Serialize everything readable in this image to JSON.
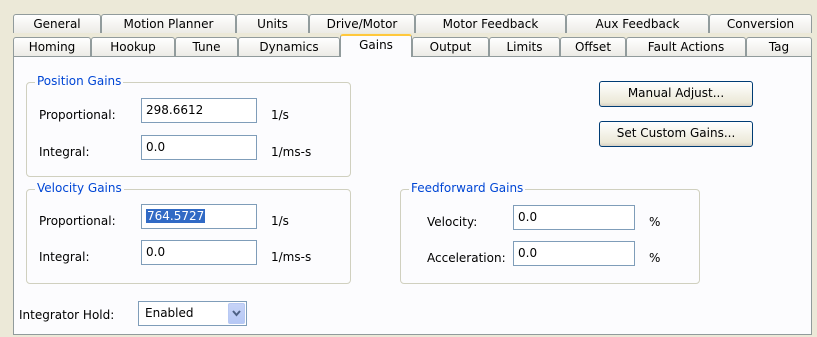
{
  "tabs_row1": [
    {
      "label": "General"
    },
    {
      "label": "Motion Planner"
    },
    {
      "label": "Units"
    },
    {
      "label": "Drive/Motor"
    },
    {
      "label": "Motor Feedback"
    },
    {
      "label": "Aux Feedback"
    },
    {
      "label": "Conversion"
    }
  ],
  "tabs_row2": [
    {
      "label": "Homing"
    },
    {
      "label": "Hookup"
    },
    {
      "label": "Tune"
    },
    {
      "label": "Dynamics"
    },
    {
      "label": "Gains"
    },
    {
      "label": "Output"
    },
    {
      "label": "Limits"
    },
    {
      "label": "Offset"
    },
    {
      "label": "Fault Actions"
    },
    {
      "label": "Tag"
    }
  ],
  "active_tab": "Gains",
  "position_gains": {
    "legend": "Position Gains",
    "proportional": {
      "label": "Proportional:",
      "value": "298.6612",
      "unit": "1/s"
    },
    "integral": {
      "label": "Integral:",
      "value": "0.0",
      "unit": "1/ms-s"
    }
  },
  "velocity_gains": {
    "legend": "Velocity Gains",
    "proportional": {
      "label": "Proportional:",
      "value": "764.5727",
      "unit": "1/s"
    },
    "integral": {
      "label": "Integral:",
      "value": "0.0",
      "unit": "1/ms-s"
    }
  },
  "feedforward_gains": {
    "legend": "Feedforward Gains",
    "velocity": {
      "label": "Velocity:",
      "value": "0.0",
      "unit": "%"
    },
    "acceleration": {
      "label": "Acceleration:",
      "value": "0.0",
      "unit": "%"
    }
  },
  "buttons": {
    "manual_adjust": "Manual Adjust...",
    "set_custom_gains": "Set Custom Gains..."
  },
  "integrator_hold": {
    "label": "Integrator Hold:",
    "value": "Enabled"
  },
  "colors": {
    "legend": "#0046d5",
    "selection": "#316ac5",
    "active_tab_accent": "#ffc83c"
  }
}
